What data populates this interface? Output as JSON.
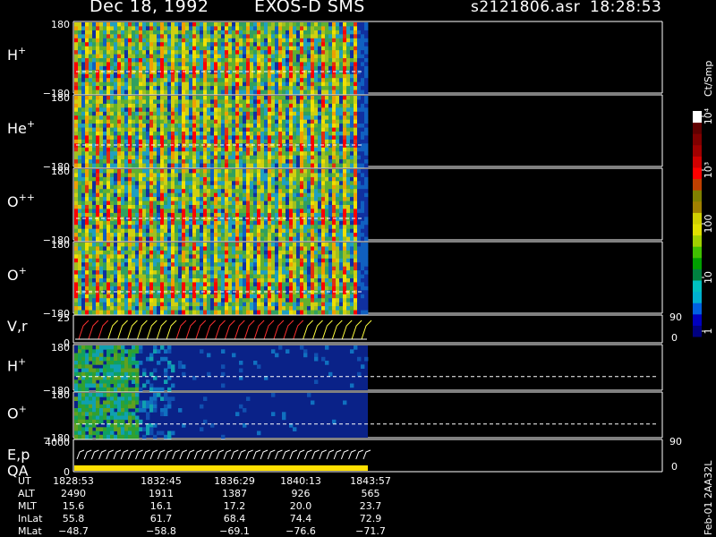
{
  "header": {
    "date": "Dec 18, 1992",
    "instrument": "EXOS-D SMS",
    "file": "s2121806.asr",
    "time": "18:28:53"
  },
  "colorbar": {
    "unit": "Ct/Smp",
    "ticks": [
      "1",
      "10",
      "100",
      "10³",
      "10⁴"
    ],
    "colors": [
      "#000080",
      "#0000c0",
      "#0060e0",
      "#00b0d0",
      "#00c0c0",
      "#008040",
      "#00a000",
      "#40c000",
      "#a0d000",
      "#e0e000",
      "#d0d000",
      "#a08000",
      "#808000",
      "#c04000",
      "#ff0000",
      "#d00000",
      "#a00000",
      "#800000",
      "#600000",
      "#ffffff"
    ]
  },
  "chart_data": {
    "type": "heatmap",
    "panels": [
      {
        "label": "H",
        "superscript": "+",
        "y_top": "180",
        "y_bottom": "−180",
        "kind": "spin"
      },
      {
        "label": "He",
        "superscript": "+",
        "y_top": "180",
        "y_bottom": "−180",
        "kind": "spin"
      },
      {
        "label": "O",
        "superscript": "++",
        "y_top": "180",
        "y_bottom": "−180",
        "kind": "spin"
      },
      {
        "label": "O",
        "superscript": "+",
        "y_top": "180",
        "y_bottom": "−180",
        "kind": "spin"
      },
      {
        "label": "V,r",
        "superscript": "",
        "y_top": "25",
        "y_bottom": "0",
        "right_top": "90",
        "right_bottom": "0",
        "kind": "vr"
      },
      {
        "label": "H",
        "superscript": "+",
        "y_top": "180",
        "y_bottom": "−180",
        "kind": "sparse"
      },
      {
        "label": "O",
        "superscript": "+",
        "y_top": "180",
        "y_bottom": "−180",
        "kind": "sparse"
      },
      {
        "label": "E,p",
        "label2": "QA",
        "superscript": "",
        "y_top": "4000",
        "y_bottom": "0",
        "right_top": "90",
        "right_bottom": "0",
        "kind": "ep"
      }
    ],
    "x_ticks": [
      "1828:53",
      "1832:45",
      "1836:29",
      "1840:13",
      "1843:57"
    ],
    "data_end_fraction": 1.0
  },
  "ephemeris": {
    "rows": [
      {
        "name": "UT",
        "values": [
          "1828:53",
          "1832:45",
          "1836:29",
          "1840:13",
          "1843:57"
        ]
      },
      {
        "name": "ALT",
        "values": [
          "2490",
          "1911",
          "1387",
          "926",
          "565"
        ]
      },
      {
        "name": "MLT",
        "values": [
          "15.6",
          "16.1",
          "17.2",
          "20.0",
          "23.7"
        ]
      },
      {
        "name": "InLat",
        "values": [
          "55.8",
          "61.7",
          "68.4",
          "74.4",
          "72.9"
        ]
      },
      {
        "name": "MLat",
        "values": [
          "−48.7",
          "−58.8",
          "−69.1",
          "−76.6",
          "−71.7"
        ]
      }
    ]
  },
  "footer": {
    "version": "Feb-01 2AA32L"
  }
}
